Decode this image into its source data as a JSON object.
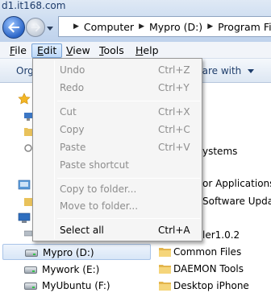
{
  "watermark": "d1.it168.com",
  "address": {
    "crumbs": [
      "Computer",
      "Mypro (D:)",
      "Program File"
    ]
  },
  "menubar": {
    "items": [
      {
        "label_first": "F",
        "label_rest": "ile"
      },
      {
        "label_first": "E",
        "label_rest": "dit"
      },
      {
        "label_first": "V",
        "label_rest": "iew"
      },
      {
        "label_first": "T",
        "label_rest": "ools"
      },
      {
        "label_first": "H",
        "label_rest": "elp"
      }
    ]
  },
  "toolbar": {
    "organize_partial": "Org",
    "share_partial": "hare with"
  },
  "edit_menu": {
    "items": [
      {
        "label": "Undo",
        "shortcut": "Ctrl+Z",
        "enabled": false
      },
      {
        "label": "Redo",
        "shortcut": "Ctrl+Y",
        "enabled": false
      },
      {
        "label": "Cut",
        "shortcut": "Ctrl+X",
        "enabled": false
      },
      {
        "label": "Copy",
        "shortcut": "Ctrl+C",
        "enabled": false
      },
      {
        "label": "Paste",
        "shortcut": "Ctrl+V",
        "enabled": false
      },
      {
        "label": "Paste shortcut",
        "shortcut": "",
        "enabled": false
      },
      {
        "label": "Copy to folder...",
        "shortcut": "",
        "enabled": false
      },
      {
        "label": "Move to folder...",
        "shortcut": "",
        "enabled": false
      },
      {
        "label": "Select all",
        "shortcut": "Ctrl+A",
        "enabled": true
      }
    ]
  },
  "nav_pane": {
    "drives": [
      {
        "label": "Mypro (D:)",
        "selected": true
      },
      {
        "label": "Mywork (E:)",
        "selected": false
      },
      {
        "label": "MyUbuntu (F:)",
        "selected": false
      }
    ]
  },
  "file_list": {
    "partial_rows": [
      "k",
      "ystems",
      "or Applications",
      "Software Update",
      "ler1.0.2"
    ],
    "folders": [
      "Common Files",
      "DAEMON Tools",
      "Desktop iPhone"
    ]
  }
}
